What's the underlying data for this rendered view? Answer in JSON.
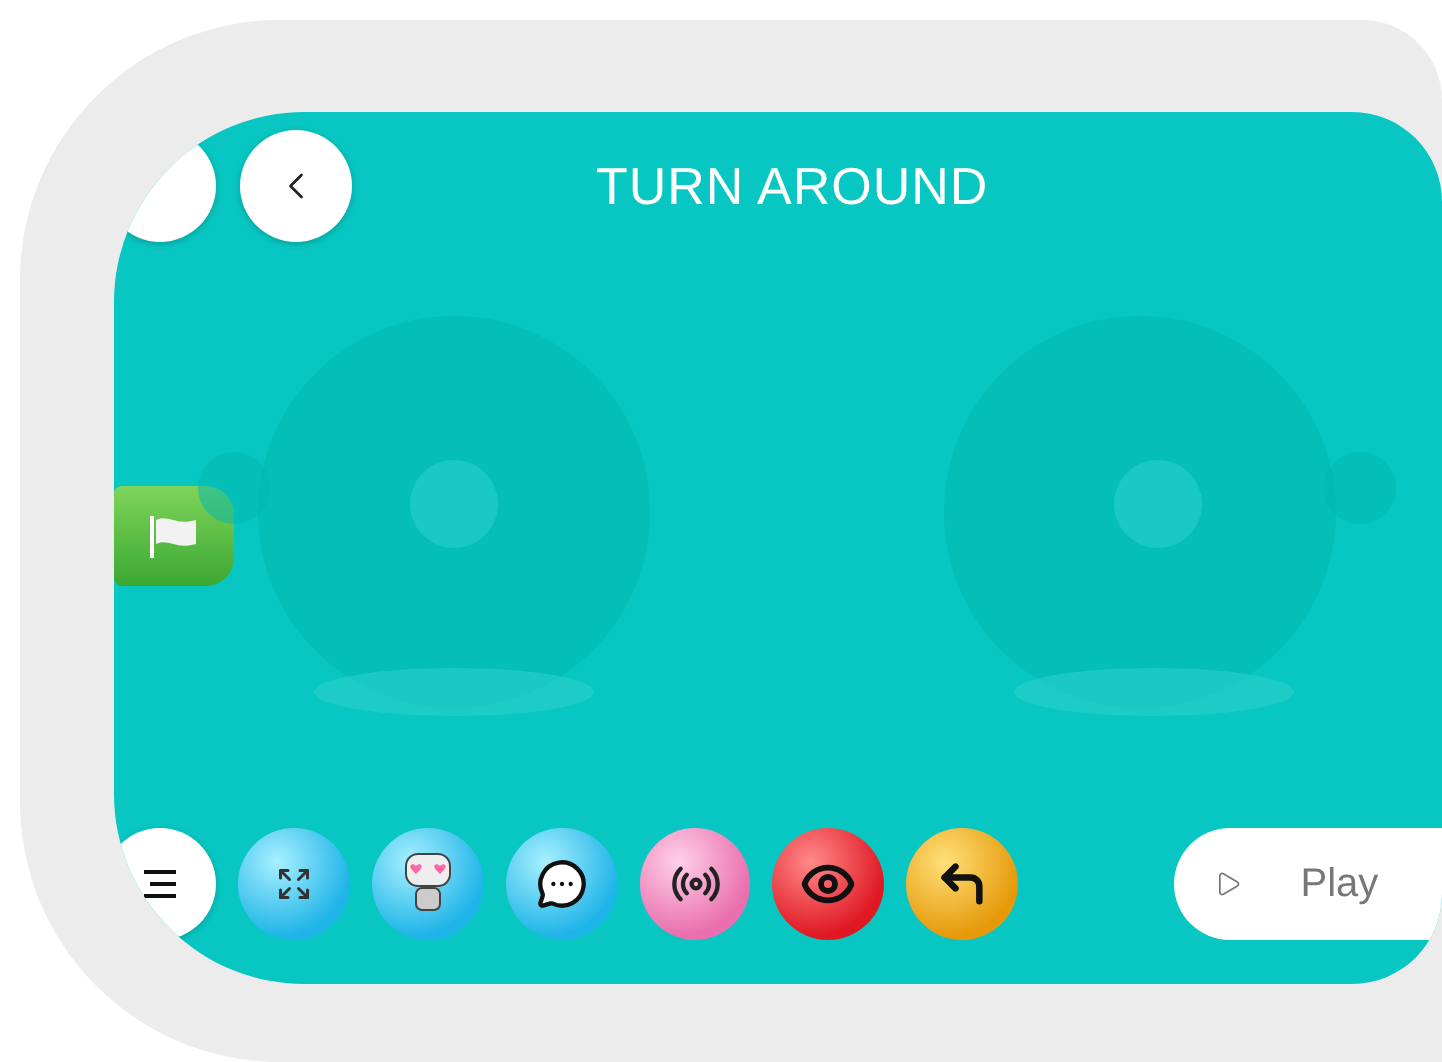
{
  "header": {
    "title": "TURN AROUND",
    "buttons": [
      {
        "kind": "partial"
      },
      {
        "kind": "back"
      }
    ]
  },
  "start_block": {
    "kind": "flag"
  },
  "toolbar": {
    "menu_button": {
      "kind": "menu"
    },
    "blocks": [
      {
        "kind": "expand"
      },
      {
        "kind": "robot"
      },
      {
        "kind": "speech"
      },
      {
        "kind": "broadcast"
      },
      {
        "kind": "eye"
      },
      {
        "kind": "turn"
      }
    ],
    "play_button": {
      "label": "Play"
    }
  }
}
